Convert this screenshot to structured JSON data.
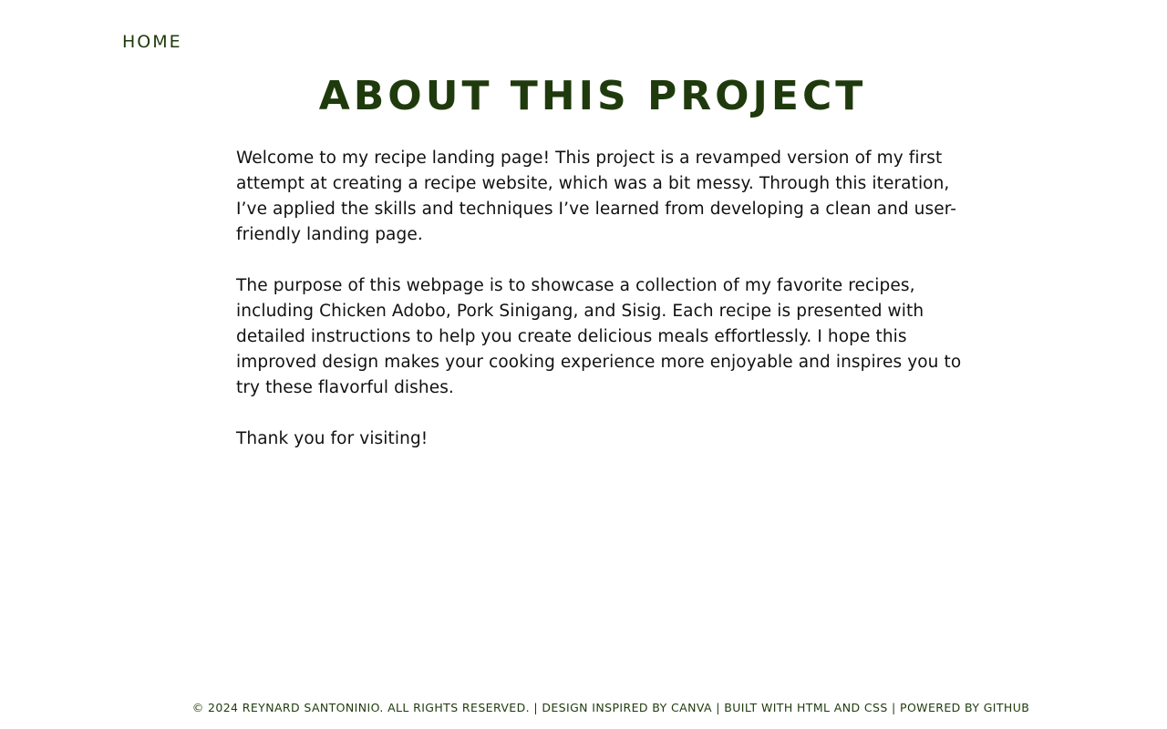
{
  "nav": {
    "home_label": "HOME"
  },
  "page": {
    "title": "ABOUT THIS PROJECT",
    "paragraphs": [
      "Welcome to my recipe landing page! This project is a revamped version of my first attempt at creating a recipe website, which was a bit messy. Through this iteration, I’ve applied the skills and techniques I’ve learned from developing a clean and user-friendly landing page.",
      "The purpose of this webpage is to showcase a collection of my favorite recipes, including Chicken Adobo, Pork Sinigang, and Sisig. Each recipe is presented with detailed instructions to help you create delicious meals effortlessly. I hope this improved design makes your cooking experience more enjoyable and inspires you to try these flavorful dishes.",
      "Thank you for visiting!"
    ]
  },
  "footer": {
    "text": "© 2024 REYNARD SANTONINIO. ALL RIGHTS RESERVED. | DESIGN INSPIRED BY CANVA | BUILT WITH HTML AND CSS | POWERED BY GITHUB"
  },
  "colors": {
    "accent": "#1f3a0c",
    "body_text": "#111111",
    "background": "#ffffff"
  }
}
